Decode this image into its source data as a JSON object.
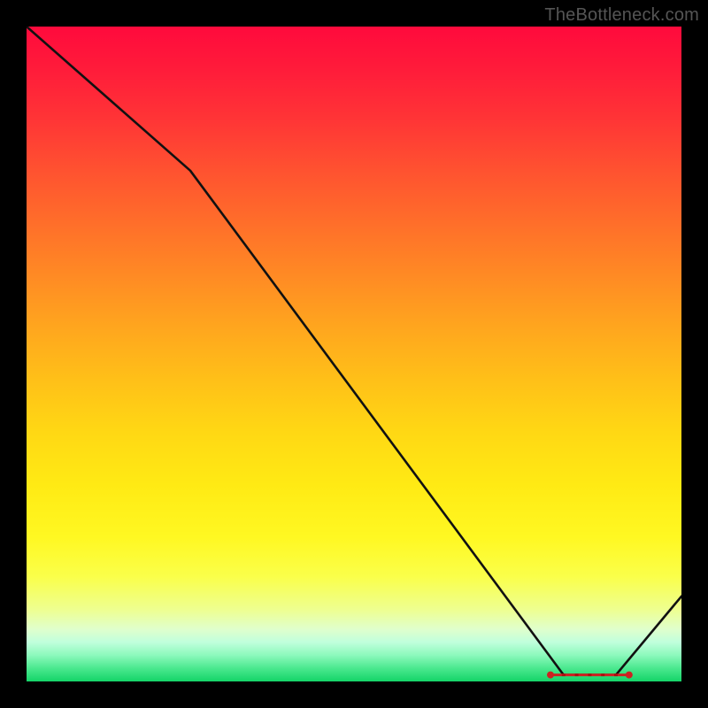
{
  "attribution": "TheBottleneck.com",
  "chart_data": {
    "type": "line",
    "title": "",
    "xlabel": "",
    "ylabel": "",
    "xlim": [
      0,
      100
    ],
    "ylim": [
      0,
      100
    ],
    "x": [
      0,
      25,
      82,
      90,
      100
    ],
    "values": [
      100,
      78,
      1,
      1,
      13
    ],
    "annotations": [
      {
        "type": "marker-segment",
        "x_start": 80,
        "x_end": 92,
        "y": 1
      }
    ],
    "background": "vertical-gradient red→orange→yellow→green",
    "grid": false
  }
}
